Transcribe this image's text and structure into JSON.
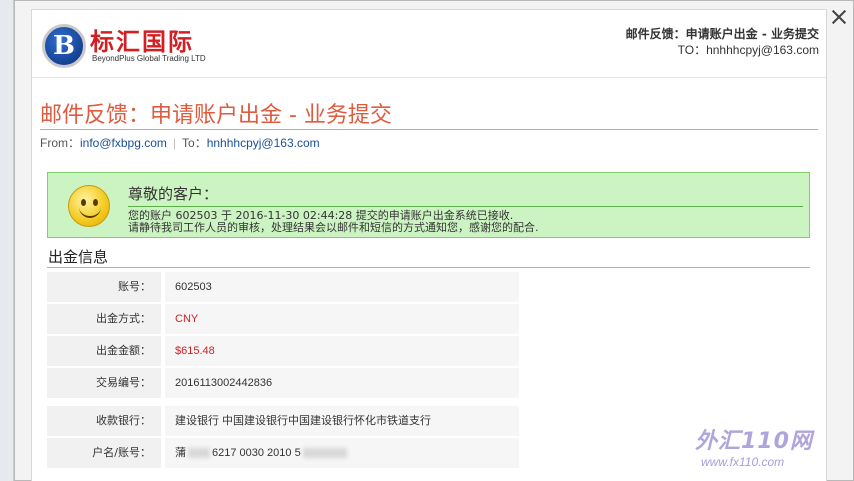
{
  "logo": {
    "cn": "标汇国际",
    "en": "BeyondPlus Global Trading LTD",
    "mark": "B"
  },
  "header": {
    "title": "邮件反馈：申请账户出金 - 业务提交",
    "to": "TO：hnhhhcpyj@163.com"
  },
  "mail": {
    "title": "邮件反馈：申请账户出金 - 业务提交",
    "from_label": "From：",
    "from_email": "info@fxbpg.com",
    "separator": "|",
    "to_label": "To：",
    "to_email": "hnhhhcpyj@163.com"
  },
  "notice": {
    "greeting": "尊敬的客户：",
    "line1": "您的账户 602503 于 2016-11-30 02:44:28 提交的申请账户出金系统已接收.",
    "line2": "请静待我司工作人员的审核，处理结果会以邮件和短信的方式通知您，感谢您的配合."
  },
  "section": {
    "title": "出金信息"
  },
  "rows": [
    {
      "label": "账号：",
      "value": "602503"
    },
    {
      "label": "出金方式：",
      "value": "CNY"
    },
    {
      "label": "出金金额：",
      "value": "$615.48"
    },
    {
      "label": "交易编号：",
      "value": "2016113002442836"
    },
    {
      "label": "收款银行：",
      "value": "建设银行 中国建设银行中国建设银行怀化市铁道支行"
    },
    {
      "label": "户名/账号：",
      "value_prefix": "蒲",
      "value_mid": "6217 0030 2010 5"
    }
  ],
  "watermark": {
    "main": "外汇110网",
    "sub": "www.fx110.com"
  },
  "colors": {
    "title_red": "#e05a3e",
    "notice_bg": "#ccf3c2",
    "value_red": "#d21f24"
  }
}
